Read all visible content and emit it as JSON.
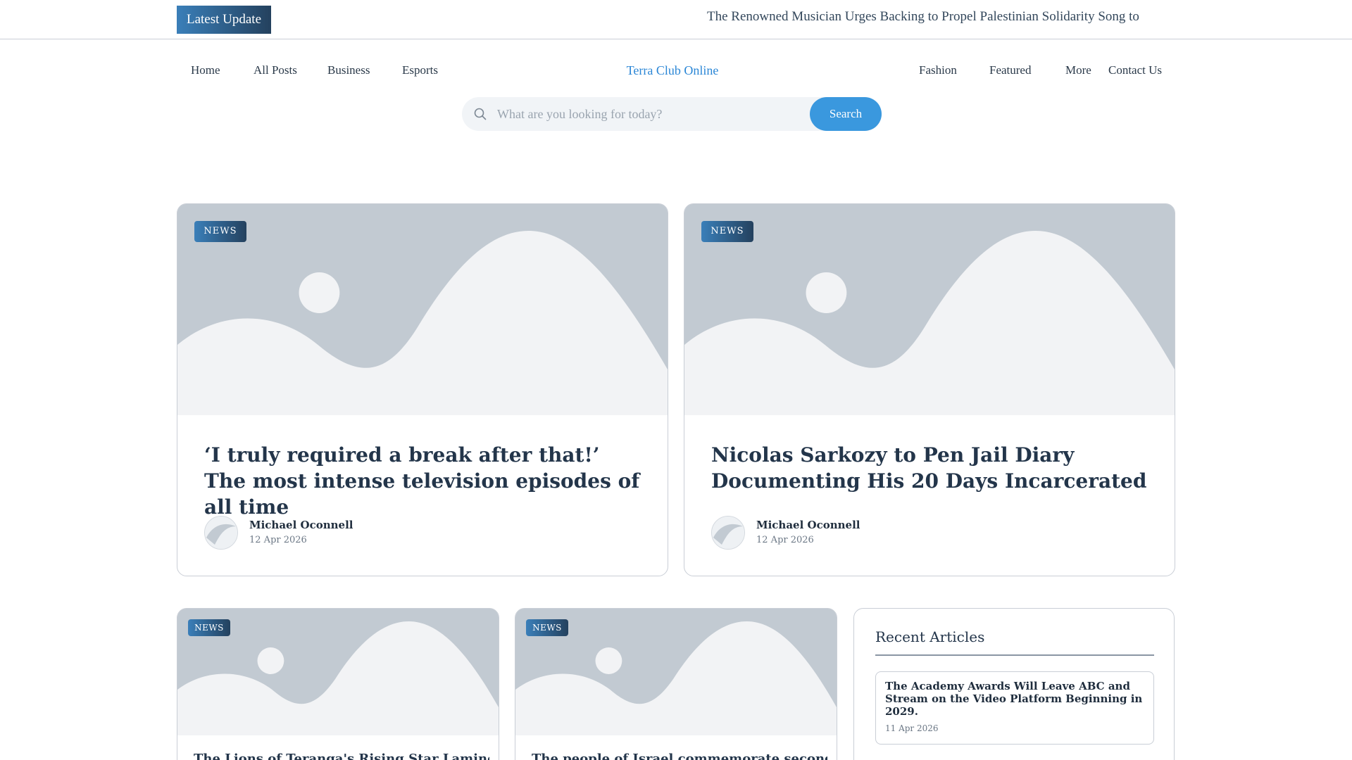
{
  "topbar": {
    "latest_label": "Latest Update",
    "ticker_text": "The Renowned Musician Urges Backing to Propel Palestinian Solidarity Song to"
  },
  "nav": {
    "left": [
      "Home",
      "All Posts",
      "Business",
      "Esports"
    ],
    "brand": "Terra Club Online",
    "right": [
      "Fashion",
      "Featured",
      "More",
      "Contact Us"
    ]
  },
  "search": {
    "placeholder": "What are you looking for today?",
    "button_label": "Search",
    "icon": "search-icon"
  },
  "featured": [
    {
      "tag": "NEWS",
      "title": "‘I truly required a break after that!’ The most intense television episodes of all time",
      "author": "Michael Oconnell",
      "date": "12 Apr 2026"
    },
    {
      "tag": "NEWS",
      "title": "Nicolas Sarkozy to Pen Jail Diary Documenting His 20 Days Incarcerated",
      "author": "Michael Oconnell",
      "date": "12 Apr 2026"
    }
  ],
  "secondary": [
    {
      "tag": "NEWS",
      "title": "The Lions of Teranga's Rising Star Lamine"
    },
    {
      "tag": "NEWS",
      "title": "The people of Israel commemorate second"
    }
  ],
  "sidebar": {
    "title": "Recent Articles",
    "items": [
      {
        "title": "The Academy Awards Will Leave ABC and Stream on the Video Platform Beginning in 2029.",
        "date": "11 Apr 2026"
      }
    ]
  },
  "colors": {
    "accent": "#3a98de",
    "brand": "#2a86d6",
    "badge_start": "#3a7fb9",
    "badge_end": "#24415e",
    "placeholder_bg": "#c2cad2",
    "placeholder_fg": "#f2f3f5"
  }
}
